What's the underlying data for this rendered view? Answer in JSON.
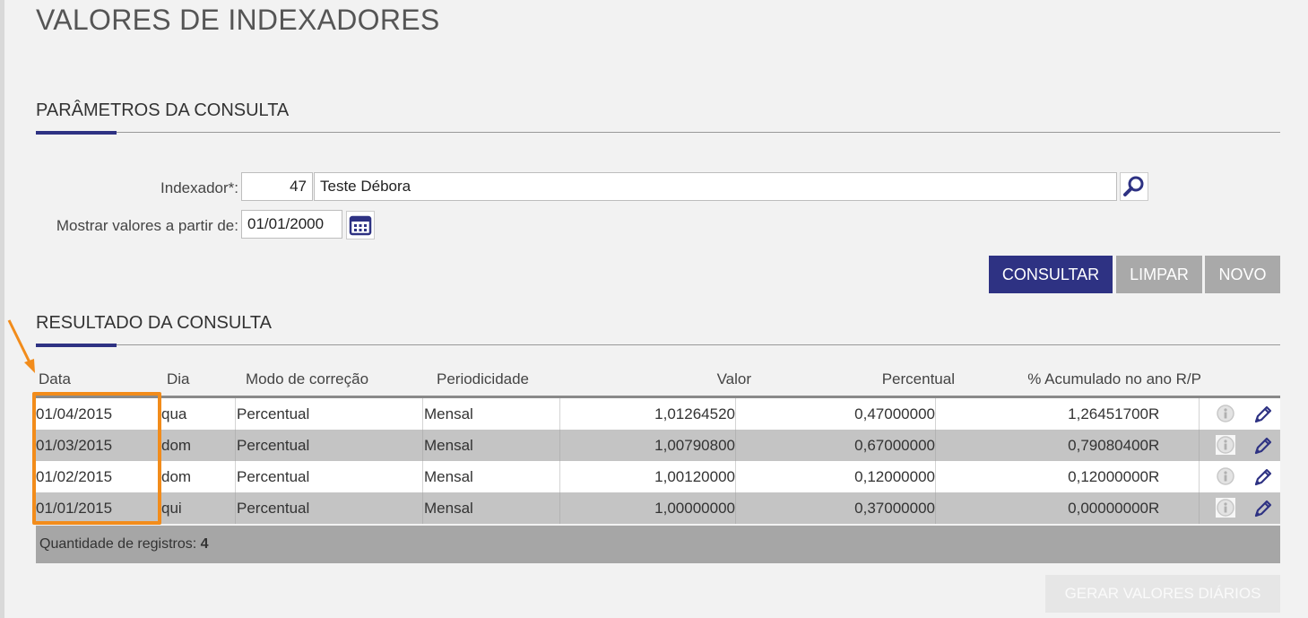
{
  "page": {
    "title": "VALORES DE INDEXADORES"
  },
  "params": {
    "section_title": "PARÂMETROS DA CONSULTA",
    "indexador_label": "Indexador*:",
    "indexador_code": "47",
    "indexador_name": "Teste Débora",
    "from_label": "Mostrar valores a partir de:",
    "from_date": "01/01/2000",
    "search_icon": "search-icon",
    "calendar_icon": "calendar-icon"
  },
  "actions": {
    "consultar": "CONSULTAR",
    "limpar": "LIMPAR",
    "novo": "NOVO"
  },
  "results": {
    "section_title": "RESULTADO DA CONSULTA",
    "columns": {
      "data": "Data",
      "dia": "Dia",
      "modo": "Modo de correção",
      "periodicidade": "Periodicidade",
      "valor": "Valor",
      "percentual": "Percentual",
      "acumulado": "% Acumulado no ano R/P"
    },
    "rows": [
      {
        "data": "01/04/2015",
        "dia": "qua",
        "modo": "Percentual",
        "periodicidade": "Mensal",
        "valor": "1,01264520",
        "percentual": "0,47000000",
        "acumulado": "1,26451700",
        "rp": "R"
      },
      {
        "data": "01/03/2015",
        "dia": "dom",
        "modo": "Percentual",
        "periodicidade": "Mensal",
        "valor": "1,00790800",
        "percentual": "0,67000000",
        "acumulado": "0,79080400",
        "rp": "R"
      },
      {
        "data": "01/02/2015",
        "dia": "dom",
        "modo": "Percentual",
        "periodicidade": "Mensal",
        "valor": "1,00120000",
        "percentual": "0,12000000",
        "acumulado": "0,12000000",
        "rp": "R"
      },
      {
        "data": "01/01/2015",
        "dia": "qui",
        "modo": "Percentual",
        "periodicidade": "Mensal",
        "valor": "1,00000000",
        "percentual": "0,37000000",
        "acumulado": "0,00000000",
        "rp": "R"
      }
    ],
    "count_label": "Quantidade de registros:",
    "count_value": "4",
    "gerar_label": "GERAR VALORES DIÁRIOS"
  },
  "colors": {
    "primary": "#2e3283",
    "gray_button": "#a9a9a9",
    "highlight": "#f28c1b"
  }
}
